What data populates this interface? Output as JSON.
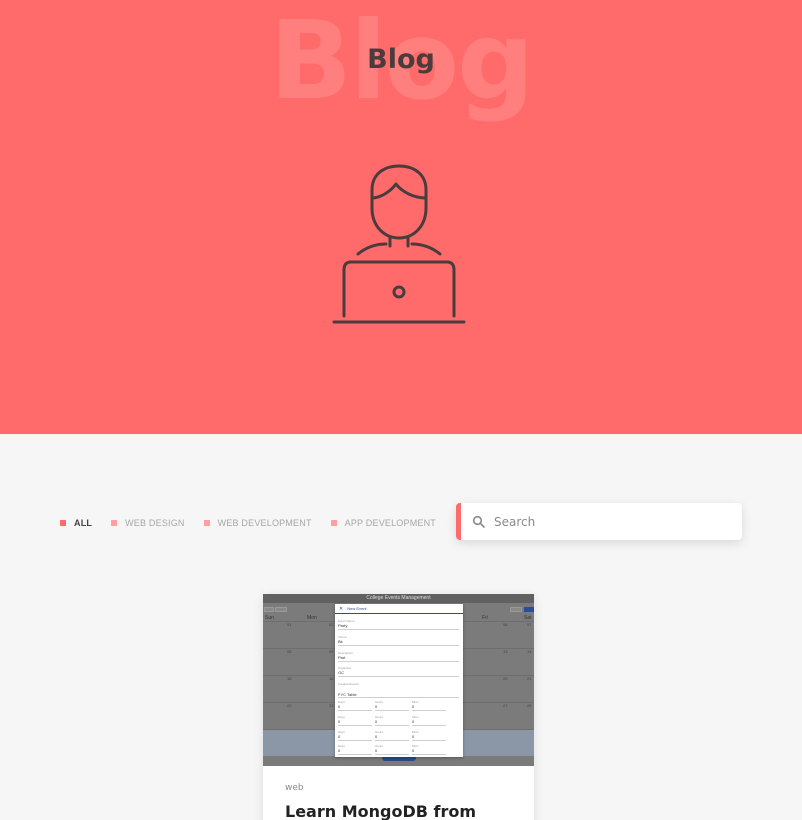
{
  "hero": {
    "bg_word": "Blog",
    "title": "Blog",
    "background_color": "#ff6b6b",
    "illustration": "person-at-laptop-icon"
  },
  "filters": [
    {
      "label": "ALL",
      "active": true
    },
    {
      "label": "WEB DESIGN",
      "active": false
    },
    {
      "label": "WEB DEVELOPMENT",
      "active": false
    },
    {
      "label": "APP DEVELOPMENT",
      "active": false
    }
  ],
  "search": {
    "placeholder": "Search",
    "value": "",
    "icon": "search-icon",
    "accent_color": "#ff6b6b"
  },
  "posts": [
    {
      "category": "web",
      "title": "Learn MongoDB from",
      "thumbnail": {
        "app_title": "College Events Management",
        "weekdays": [
          "Sun",
          "Mon",
          "Fri",
          "Sat"
        ],
        "dates_left": [
          "01",
          "08",
          "15",
          "22",
          "29"
        ],
        "dates_mon": [
          "02",
          "09",
          "16",
          "23",
          "30"
        ],
        "dates_fri": [
          "06",
          "13",
          "20",
          "27"
        ],
        "dates_sat": [
          "07",
          "14",
          "21",
          "28"
        ],
        "buttons": [
          "Back",
          "Next",
          "Today",
          "Month"
        ],
        "modal": {
          "title": "New Event",
          "fields": [
            {
              "label": "Event Name",
              "value": "Party"
            },
            {
              "label": "Venue",
              "value": "Bk"
            },
            {
              "label": "Description",
              "value": "Part"
            },
            {
              "label": "Organiser",
              "value": "GC"
            },
            {
              "label": "Created Events",
              "value": "FYC Table"
            }
          ],
          "rows": [
            [
              {
                "label": "Days",
                "value": "0"
              },
              {
                "label": "Hours",
                "value": "0"
              },
              {
                "label": "Mins",
                "value": "0"
              }
            ],
            [
              {
                "label": "Days",
                "value": "0"
              },
              {
                "label": "Hours",
                "value": "0"
              },
              {
                "label": "Mins",
                "value": "0"
              }
            ],
            [
              {
                "label": "Days",
                "value": "0"
              },
              {
                "label": "Hours",
                "value": "0"
              },
              {
                "label": "Mins",
                "value": "0"
              }
            ],
            [
              {
                "label": "Days",
                "value": "0"
              },
              {
                "label": "Hours",
                "value": "0"
              },
              {
                "label": "Mins",
                "value": "0"
              }
            ]
          ]
        }
      }
    }
  ]
}
